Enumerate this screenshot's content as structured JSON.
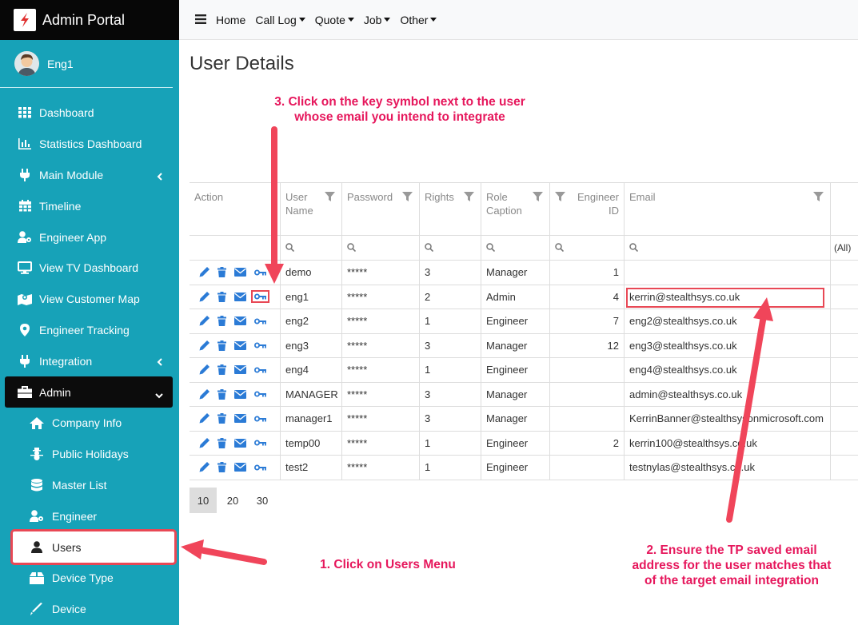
{
  "app": {
    "title": "Admin Portal"
  },
  "user": {
    "name": "Eng1"
  },
  "sidebar": {
    "items": [
      {
        "label": "Dashboard",
        "icon": "grid-icon"
      },
      {
        "label": "Statistics Dashboard",
        "icon": "bar-chart-icon"
      },
      {
        "label": "Main Module",
        "icon": "plug-icon"
      },
      {
        "label": "Timeline",
        "icon": "calendar-icon"
      },
      {
        "label": "Engineer App",
        "icon": "user-cog-icon"
      },
      {
        "label": "View TV Dashboard",
        "icon": "monitor-icon"
      },
      {
        "label": "View Customer Map",
        "icon": "map-icon"
      },
      {
        "label": "Engineer Tracking",
        "icon": "location-pin-icon"
      },
      {
        "label": "Integration",
        "icon": "plug-icon"
      },
      {
        "label": "Admin",
        "icon": "toolbox-icon"
      }
    ],
    "sub_items": [
      {
        "label": "Company Info",
        "icon": "home-icon"
      },
      {
        "label": "Public Holidays",
        "icon": "snowman-icon"
      },
      {
        "label": "Master List",
        "icon": "database-icon"
      },
      {
        "label": "Engineer",
        "icon": "user-cog-icon"
      },
      {
        "label": "Users",
        "icon": "user-icon"
      },
      {
        "label": "Device Type",
        "icon": "box-icon"
      },
      {
        "label": "Device",
        "icon": "pen-icon"
      }
    ]
  },
  "topbar": {
    "home": "Home",
    "call_log": "Call Log",
    "quote": "Quote",
    "job": "Job",
    "other": "Other"
  },
  "page": {
    "title": "User Details"
  },
  "grid": {
    "headers": {
      "action": "Action",
      "user_name_1": "User",
      "user_name_2": "Name",
      "password": "Password",
      "rights": "Rights",
      "role_1": "Role",
      "role_2": "Caption",
      "engineer_1": "Engineer",
      "engineer_2": "ID",
      "email": "Email",
      "all_filter": "(All)"
    },
    "rows": [
      {
        "user": "demo",
        "password": "*****",
        "rights": "3",
        "role": "Manager",
        "engineer_id": "1",
        "email": ""
      },
      {
        "user": "eng1",
        "password": "*****",
        "rights": "2",
        "role": "Admin",
        "engineer_id": "4",
        "email": "kerrin@stealthsys.co.uk"
      },
      {
        "user": "eng2",
        "password": "*****",
        "rights": "1",
        "role": "Engineer",
        "engineer_id": "7",
        "email": "eng2@stealthsys.co.uk"
      },
      {
        "user": "eng3",
        "password": "*****",
        "rights": "3",
        "role": "Manager",
        "engineer_id": "12",
        "email": "eng3@stealthsys.co.uk"
      },
      {
        "user": "eng4",
        "password": "*****",
        "rights": "1",
        "role": "Engineer",
        "engineer_id": "",
        "email": "eng4@stealthsys.co.uk"
      },
      {
        "user": "MANAGER",
        "password": "*****",
        "rights": "3",
        "role": "Manager",
        "engineer_id": "",
        "email": "admin@stealthsys.co.uk"
      },
      {
        "user": "manager1",
        "password": "*****",
        "rights": "3",
        "role": "Manager",
        "engineer_id": "",
        "email": "KerrinBanner@stealthsysonmicrosoft.com"
      },
      {
        "user": "temp00",
        "password": "*****",
        "rights": "1",
        "role": "Engineer",
        "engineer_id": "2",
        "email": "kerrin100@stealthsys.co.uk"
      },
      {
        "user": "test2",
        "password": "*****",
        "rights": "1",
        "role": "Engineer",
        "engineer_id": "",
        "email": "testnylas@stealthsys.co.uk"
      }
    ]
  },
  "pager": {
    "sizes": [
      "10",
      "20",
      "30"
    ],
    "selected": "10"
  },
  "annotations": {
    "step3_line1": "3. Click on the key symbol next to the user",
    "step3_line2": "whose email you intend to integrate",
    "step1": "1. Click on Users Menu",
    "step2_line1": "2. Ensure the TP saved email",
    "step2_line2": "address for the user matches that",
    "step2_line3": "of the target email integration"
  },
  "colors": {
    "sidebar": "#17a2b8",
    "accent": "#2b7bd6",
    "annotation": "#e6175c",
    "highlight": "#e84855"
  }
}
